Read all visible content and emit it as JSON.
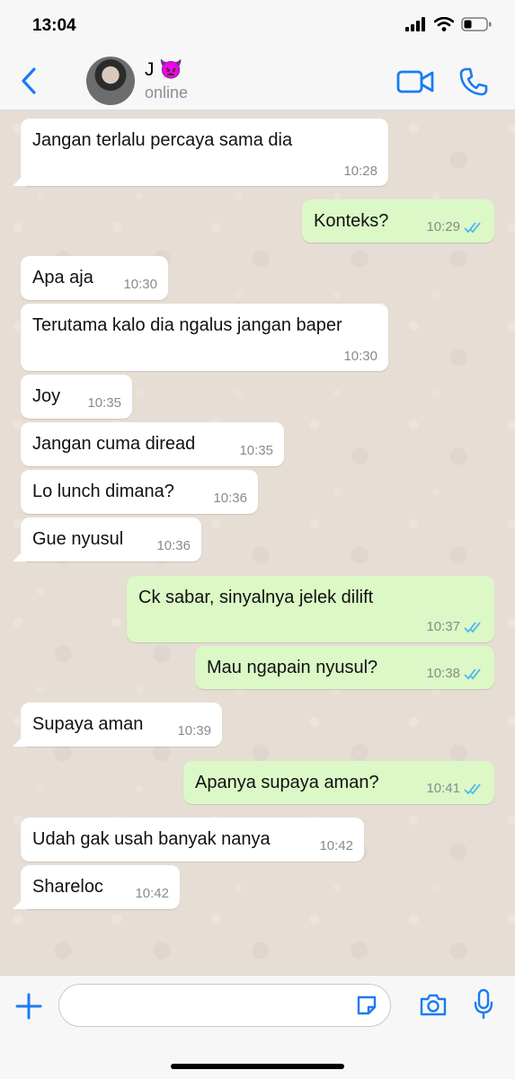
{
  "status_bar": {
    "time": "13:04",
    "battery_level": 0.3
  },
  "header": {
    "contact_name": "J 👿",
    "contact_status": "online",
    "accent_color": "#1a7cf2"
  },
  "messages": [
    {
      "direction": "in",
      "text": "Jangan terlalu percaya sama dia",
      "time": "10:28"
    },
    {
      "direction": "out",
      "text": "Konteks?",
      "time": "10:29",
      "read": true
    },
    {
      "direction": "in",
      "text": "Apa aja",
      "time": "10:30"
    },
    {
      "direction": "in",
      "text": "Terutama kalo dia ngalus jangan baper",
      "time": "10:30"
    },
    {
      "direction": "in",
      "text": "Joy",
      "time": "10:35"
    },
    {
      "direction": "in",
      "text": "Jangan cuma diread",
      "time": "10:35"
    },
    {
      "direction": "in",
      "text": "Lo lunch dimana?",
      "time": "10:36"
    },
    {
      "direction": "in",
      "text": "Gue nyusul",
      "time": "10:36"
    },
    {
      "direction": "out",
      "text": "Ck sabar, sinyalnya jelek dilift",
      "time": "10:37",
      "read": true
    },
    {
      "direction": "out",
      "text": "Mau ngapain nyusul?",
      "time": "10:38",
      "read": true
    },
    {
      "direction": "in",
      "text": "Supaya aman",
      "time": "10:39"
    },
    {
      "direction": "out",
      "text": "Apanya supaya aman?",
      "time": "10:41",
      "read": true
    },
    {
      "direction": "in",
      "text": "Udah gak usah banyak nanya",
      "time": "10:42"
    },
    {
      "direction": "in",
      "text": "Shareloc",
      "time": "10:42"
    }
  ],
  "input_bar": {
    "placeholder": ""
  },
  "icons": {
    "back": "back-chevron-icon",
    "video": "video-call-icon",
    "phone": "phone-call-icon",
    "plus": "plus-icon",
    "sticker": "sticker-icon",
    "camera": "camera-icon",
    "mic": "microphone-icon"
  },
  "colors": {
    "incoming_bubble": "#ffffff",
    "outgoing_bubble": "#dbf8c6",
    "read_ticks": "#4fb6ec",
    "chat_background": "#e6ddd4"
  }
}
